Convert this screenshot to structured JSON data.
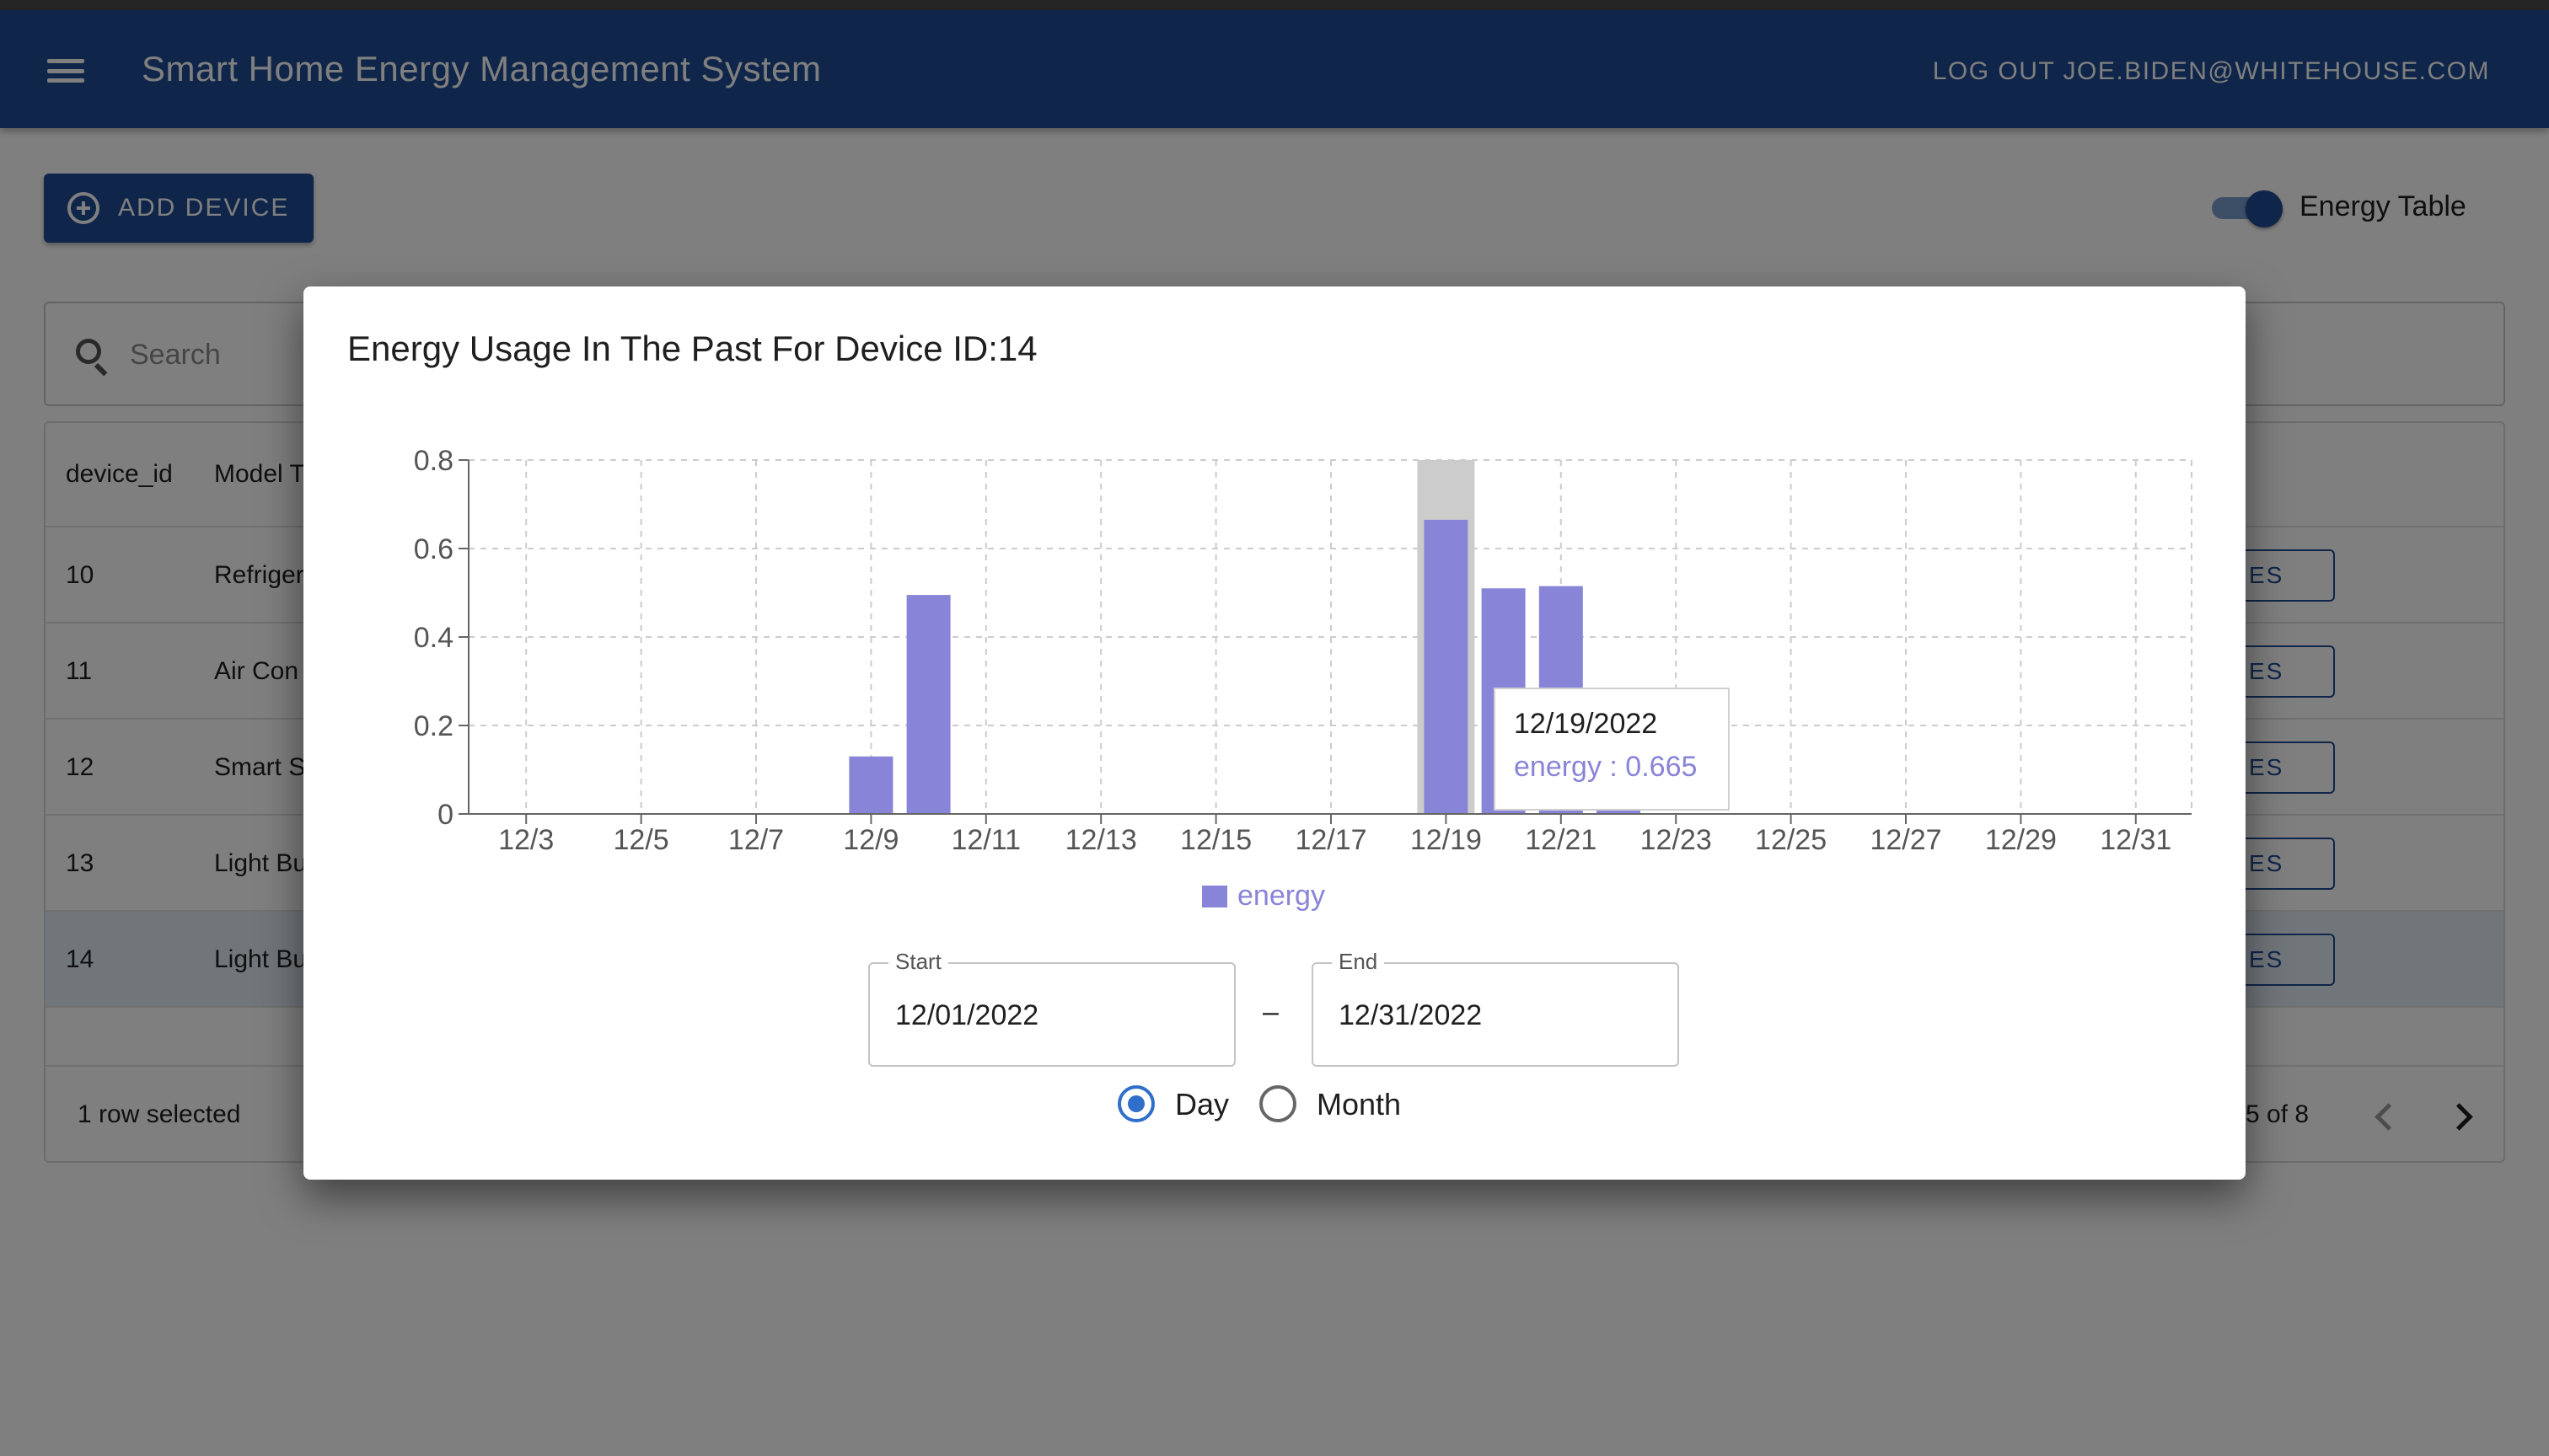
{
  "app": {
    "title": "Smart Home Energy Management System",
    "logout_label": "LOG OUT JOE.BIDEN@WHITEHOUSE.COM"
  },
  "toolbar": {
    "add_device_label": "ADD DEVICE",
    "energy_table_label": "Energy Table",
    "energy_table_on": true
  },
  "search": {
    "placeholder": "Search"
  },
  "table": {
    "columns": [
      "device_id",
      "Model T"
    ],
    "rows": [
      {
        "id": "10",
        "model": "Refriger",
        "action": "ES"
      },
      {
        "id": "11",
        "model": "Air Con",
        "action": "ES"
      },
      {
        "id": "12",
        "model": "Smart S",
        "action": "ES"
      },
      {
        "id": "13",
        "model": "Light Bu",
        "action": "ES"
      },
      {
        "id": "14",
        "model": "Light Bu",
        "action": "ES",
        "selected": true
      }
    ],
    "footer": {
      "selection_text": "1 row selected",
      "pagination_text": "5 of 8"
    }
  },
  "dialog": {
    "title": "Energy Usage In The Past For Device ID:14",
    "tooltip": {
      "label": "12/19/2022",
      "value_text": "energy : 0.665"
    },
    "legend_label": "energy",
    "start": {
      "label": "Start",
      "value": "12/01/2022"
    },
    "end": {
      "label": "End",
      "value": "12/31/2022"
    },
    "separator": "–",
    "granularity": {
      "options": [
        "Day",
        "Month"
      ],
      "selected": "Day"
    }
  },
  "colors": {
    "appbar": "#1e4d94",
    "bar": "#8884d8",
    "radio_selected": "#2f6fcb"
  },
  "chart_data": {
    "type": "bar",
    "x_tick_labels": [
      "12/3",
      "12/5",
      "12/7",
      "12/9",
      "12/11",
      "12/13",
      "12/15",
      "12/17",
      "12/19",
      "12/21",
      "12/23",
      "12/25",
      "12/27",
      "12/29",
      "12/31"
    ],
    "y_tick_labels": [
      "0",
      "0.2",
      "0.4",
      "0.6",
      "0.8"
    ],
    "ylim": [
      0,
      0.8
    ],
    "series": [
      {
        "name": "energy",
        "points": [
          {
            "x": "12/9",
            "y": 0.13
          },
          {
            "x": "12/10",
            "y": 0.495
          },
          {
            "x": "12/19",
            "y": 0.665
          },
          {
            "x": "12/20",
            "y": 0.51
          },
          {
            "x": "12/21",
            "y": 0.515
          },
          {
            "x": "12/22",
            "y": 0.01
          }
        ]
      }
    ],
    "highlighted_x": "12/19",
    "grid": true,
    "legend_position": "bottom"
  }
}
